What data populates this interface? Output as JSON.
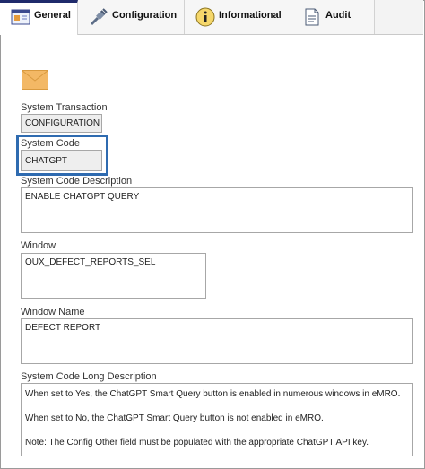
{
  "tabs": [
    {
      "label": "General",
      "icon": "general-form-icon",
      "active": true
    },
    {
      "label": "Configuration",
      "icon": "wrench-plug-icon",
      "active": false
    },
    {
      "label": "Informational",
      "icon": "info-icon",
      "active": false
    },
    {
      "label": "Audit",
      "icon": "audit-document-icon",
      "active": false
    }
  ],
  "fields": {
    "system_transaction": {
      "label": "System Transaction",
      "value": "CONFIGURATION"
    },
    "system_code": {
      "label": "System Code",
      "value": "CHATGPT"
    },
    "system_code_description": {
      "label": "System Code Description",
      "value": "ENABLE CHATGPT QUERY"
    },
    "window": {
      "label": "Window",
      "value": "OUX_DEFECT_REPORTS_SEL"
    },
    "window_name": {
      "label": "Window Name",
      "value": "DEFECT REPORT"
    },
    "long_description": {
      "label": "System Code Long Description",
      "lines": [
        "When set to Yes,  the ChatGPT Smart Query button is enabled in numerous windows in eMRO.",
        "When set to No, the ChatGPT Smart Query button is not enabled in eMRO.",
        "Note: The Config Other field must be populated with the appropriate ChatGPT API key."
      ]
    }
  },
  "colors": {
    "highlight_border": "#2f6bb0",
    "active_tab_accent": "#1f2a6b",
    "envelope": "#f3b865"
  }
}
